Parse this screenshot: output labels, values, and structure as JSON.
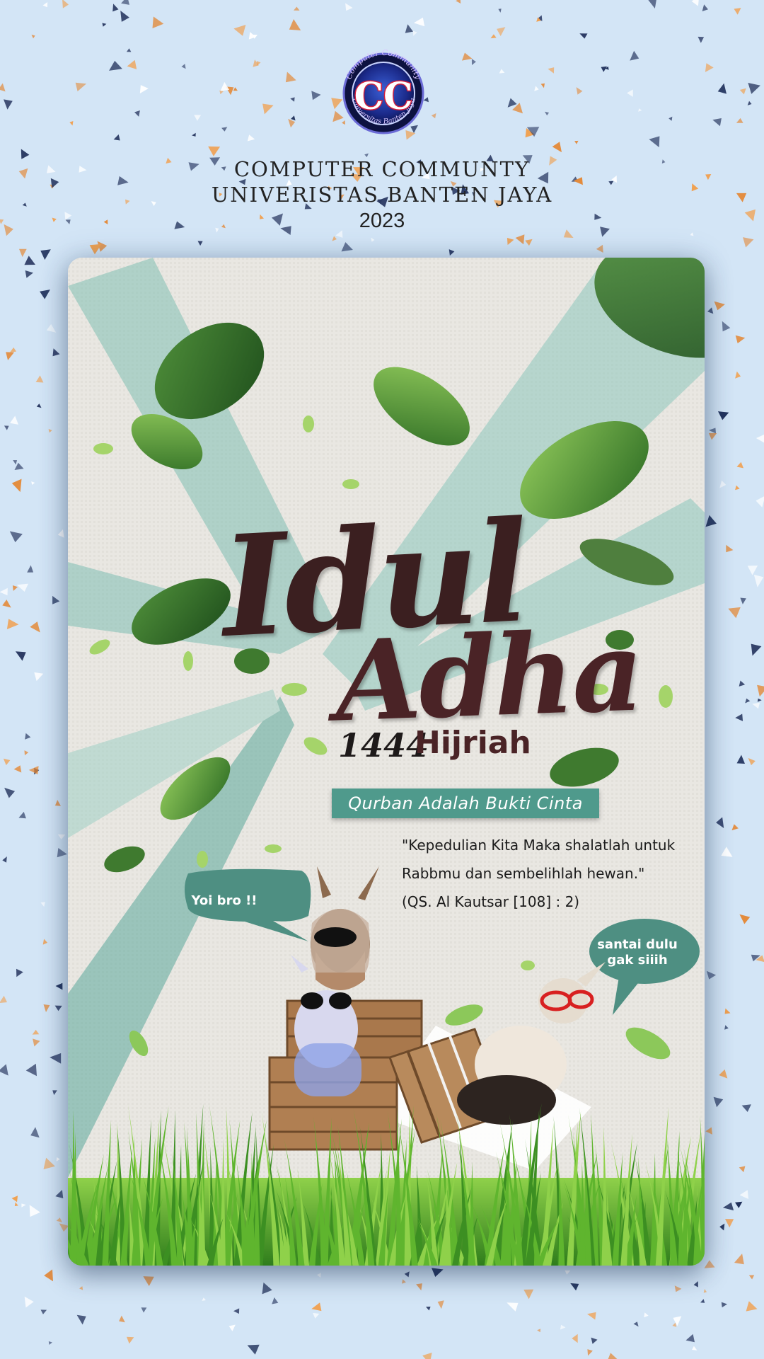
{
  "header": {
    "org_line1": "COMPUTER  COMMUNTY",
    "org_line2": "UNIVERISTAS  BANTEN  JAYA",
    "year": "2023"
  },
  "logo": {
    "top_arc_text": "Computer Community",
    "bottom_arc_text": "Universitas Banten Jaya",
    "center_letters": "CC"
  },
  "poster": {
    "title_word1": "Idul",
    "title_word2": "Adha",
    "hijri_year": "1444",
    "hijri_unit": "Hijriah",
    "banner_text": "Qurban Adalah Bukti Cinta",
    "quote_lines": [
      "\"Kepedulian Kita Maka shalatlah untuk",
      "Rabbmu dan sembelihlah hewan.\"",
      "(QS. Al Kautsar [108] : 2)"
    ],
    "bubble_left": "Yoi bro !!",
    "bubble_right_line1": "santai dulu",
    "bubble_right_line2": "gak siiih"
  },
  "colors": {
    "background": "#d3e5f6",
    "teal": "#4f9a8c",
    "title": "#3b1f20",
    "grass": "#4fa32c"
  }
}
